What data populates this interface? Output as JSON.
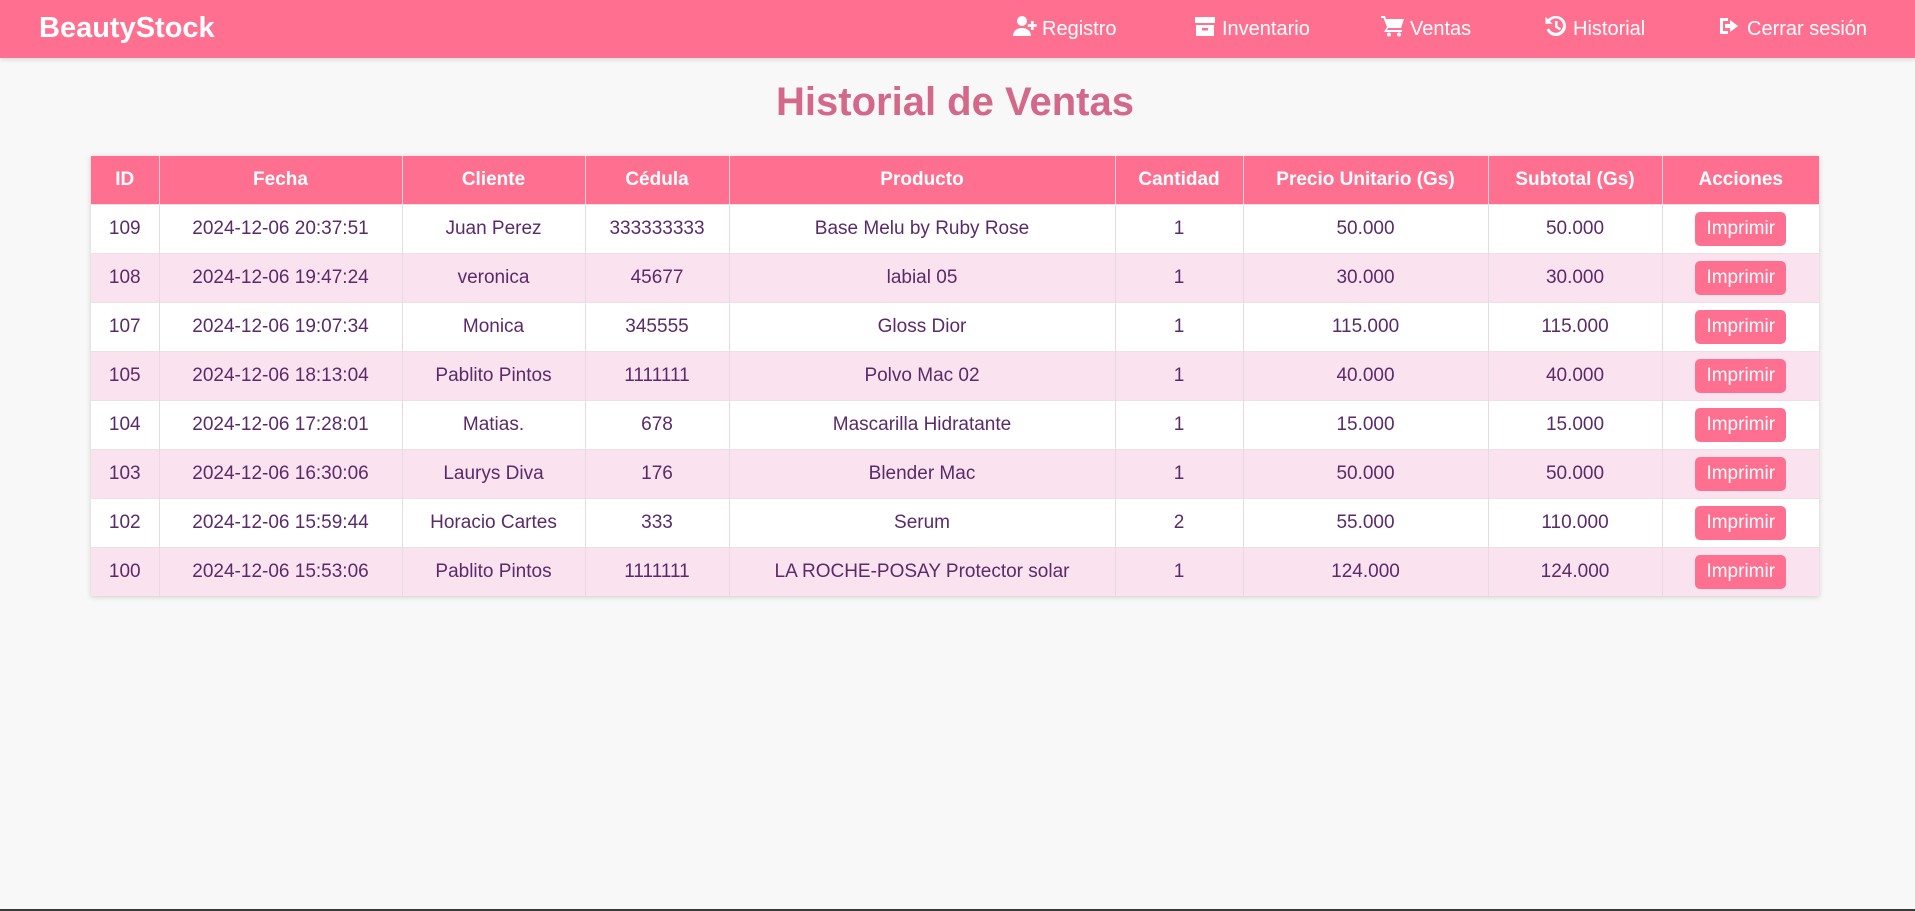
{
  "nav": {
    "brand": "BeautyStock",
    "links": [
      {
        "label": "Registro",
        "icon": "user-plus-icon"
      },
      {
        "label": "Inventario",
        "icon": "box-icon"
      },
      {
        "label": "Ventas",
        "icon": "cart-icon"
      },
      {
        "label": "Historial",
        "icon": "history-icon"
      },
      {
        "label": "Cerrar sesión",
        "icon": "sign-out-icon"
      }
    ]
  },
  "page": {
    "title": "Historial de Ventas"
  },
  "table": {
    "headers": [
      "ID",
      "Fecha",
      "Cliente",
      "Cédula",
      "Producto",
      "Cantidad",
      "Precio Unitario (Gs)",
      "Subtotal (Gs)",
      "Acciones"
    ],
    "action_label": "Imprimir",
    "rows": [
      {
        "id": "109",
        "fecha": "2024-12-06 20:37:51",
        "cliente": "Juan Perez",
        "cedula": "333333333",
        "producto": "Base Melu by Ruby Rose",
        "cantidad": "1",
        "precio": "50.000",
        "subtotal": "50.000"
      },
      {
        "id": "108",
        "fecha": "2024-12-06 19:47:24",
        "cliente": "veronica",
        "cedula": "45677",
        "producto": "labial 05",
        "cantidad": "1",
        "precio": "30.000",
        "subtotal": "30.000"
      },
      {
        "id": "107",
        "fecha": "2024-12-06 19:07:34",
        "cliente": "Monica",
        "cedula": "345555",
        "producto": "Gloss Dior",
        "cantidad": "1",
        "precio": "115.000",
        "subtotal": "115.000"
      },
      {
        "id": "105",
        "fecha": "2024-12-06 18:13:04",
        "cliente": "Pablito Pintos",
        "cedula": "1111111",
        "producto": "Polvo Mac 02",
        "cantidad": "1",
        "precio": "40.000",
        "subtotal": "40.000"
      },
      {
        "id": "104",
        "fecha": "2024-12-06 17:28:01",
        "cliente": "Matias.",
        "cedula": "678",
        "producto": "Mascarilla Hidratante",
        "cantidad": "1",
        "precio": "15.000",
        "subtotal": "15.000"
      },
      {
        "id": "103",
        "fecha": "2024-12-06 16:30:06",
        "cliente": "Laurys Diva",
        "cedula": "176",
        "producto": "Blender Mac",
        "cantidad": "1",
        "precio": "50.000",
        "subtotal": "50.000"
      },
      {
        "id": "102",
        "fecha": "2024-12-06 15:59:44",
        "cliente": "Horacio Cartes",
        "cedula": "333",
        "producto": "Serum",
        "cantidad": "2",
        "precio": "55.000",
        "subtotal": "110.000"
      },
      {
        "id": "100",
        "fecha": "2024-12-06 15:53:06",
        "cliente": "Pablito Pintos",
        "cedula": "1111111",
        "producto": "LA ROCHE-POSAY Protector solar",
        "cantidad": "1",
        "precio": "124.000",
        "subtotal": "124.000"
      }
    ]
  },
  "colors": {
    "navbar": "#ff7090",
    "title": "#d4688a",
    "row_alt": "#fae3ef",
    "text": "#5a2a6a",
    "button": "#ff6f8f"
  }
}
